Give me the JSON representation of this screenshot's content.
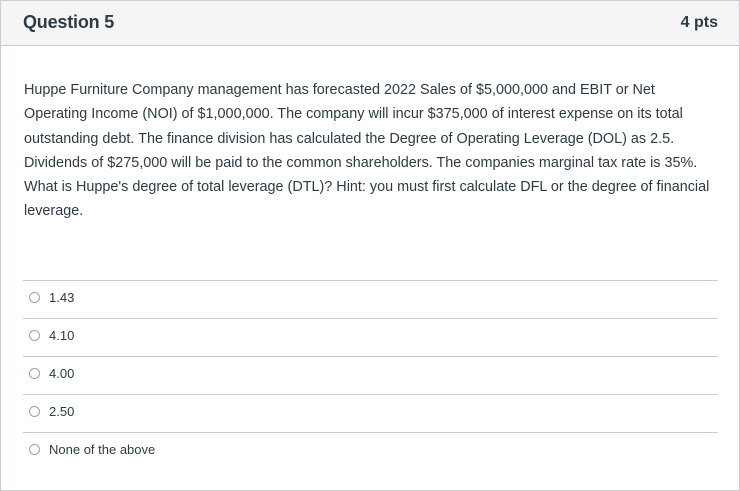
{
  "question": {
    "title": "Question 5",
    "points": "4 pts",
    "text": "Huppe Furniture Company management has forecasted 2022 Sales of $5,000,000 and EBIT or Net Operating Income (NOI) of $1,000,000. The company will incur $375,000 of interest expense on its total outstanding debt. The finance division has calculated the Degree of Operating Leverage (DOL) as 2.5. Dividends of $275,000 will be paid to the common shareholders. The companies marginal tax rate is 35%. What is Huppe's degree of total leverage (DTL)? Hint: you must first calculate DFL or the degree of financial leverage."
  },
  "answers": [
    {
      "label": "1.43",
      "selected": false
    },
    {
      "label": "4.10",
      "selected": false
    },
    {
      "label": "4.00",
      "selected": false
    },
    {
      "label": "2.50",
      "selected": false
    },
    {
      "label": "None of the above",
      "selected": false
    }
  ],
  "colors": {
    "text": "#2d3b45",
    "border": "#c7cdd1",
    "header_bg": "#f5f5f5"
  }
}
